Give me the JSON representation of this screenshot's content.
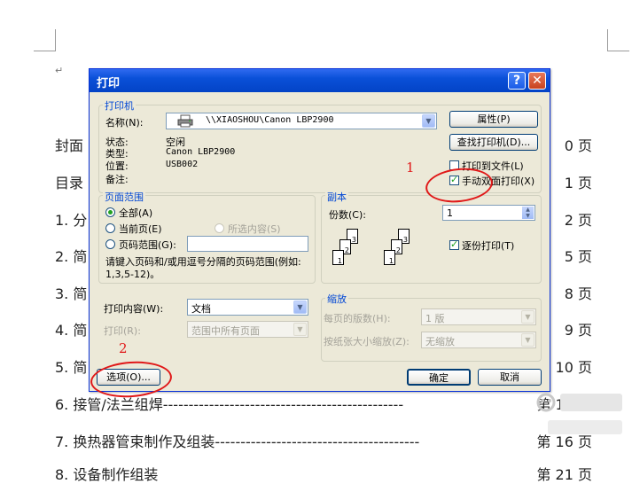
{
  "document": {
    "paragraph_mark": "↵",
    "toc": [
      {
        "left": "封面",
        "right": "0 页"
      },
      {
        "left": "目录",
        "right": "1 页"
      },
      {
        "left": "1. 分",
        "right": "2 页"
      },
      {
        "left": "2. 简",
        "right": "5 页"
      },
      {
        "left": "3. 简",
        "right": "8 页"
      },
      {
        "left": "4. 简",
        "right": "9 页"
      },
      {
        "left": "5. 简",
        "right": "10 页"
      },
      {
        "left": "6. 接管/法兰组焊-----------------------------------------------",
        "right": "第 12 页"
      },
      {
        "left": "7. 换热器管束制作及组装----------------------------------------",
        "right": "第 16 页"
      },
      {
        "left": "8. 设备制作组装",
        "right": "第 21 页"
      }
    ]
  },
  "dialog": {
    "title": "打印",
    "help_glyph": "?",
    "close_glyph": "✕",
    "printer": {
      "group_label": "打印机",
      "name_label": "名称(N):",
      "name_value": "\\\\XIAOSHOU\\Canon LBP2900",
      "status_label": "状态:",
      "status_value": "空闲",
      "type_label": "类型:",
      "type_value": "Canon LBP2900",
      "location_label": "位置:",
      "location_value": "USB002",
      "comment_label": "备注:",
      "properties_button": "属性(P)",
      "find_printer_button": "查找打印机(D)...",
      "print_to_file_label": "打印到文件(L)",
      "manual_duplex_label": "手动双面打印(X)"
    },
    "page_range": {
      "group_label": "页面范围",
      "all_label": "全部(A)",
      "current_label": "当前页(E)",
      "selection_label": "所选内容(S)",
      "pages_label": "页码范围(G):",
      "pages_value": "",
      "hint_text": "请键入页码和/或用逗号分隔的页码范围(例如: 1,3,5-12)。"
    },
    "copies": {
      "group_label": "副本",
      "count_label": "份数(C):",
      "count_value": "1",
      "collate_label": "逐份打印(T)"
    },
    "print_what": {
      "label": "打印内容(W):",
      "value": "文档"
    },
    "print": {
      "label": "打印(R):",
      "value": "范围中所有页面"
    },
    "zoom": {
      "group_label": "缩放",
      "pages_per_sheet_label": "每页的版数(H):",
      "pages_per_sheet_value": "1 版",
      "scale_label": "按纸张大小缩放(Z):",
      "scale_value": "无缩放"
    },
    "options_button": "选项(O)...",
    "ok_button": "确定",
    "cancel_button": "取消"
  },
  "annotations": {
    "mark_1": "1",
    "mark_2": "2",
    "color": "#e01818"
  },
  "icons": {
    "printer": "printer-icon",
    "dropdown": "chevron-down-icon",
    "spinner": "spinner-arrows-icon",
    "help": "help-icon",
    "close": "close-icon"
  }
}
